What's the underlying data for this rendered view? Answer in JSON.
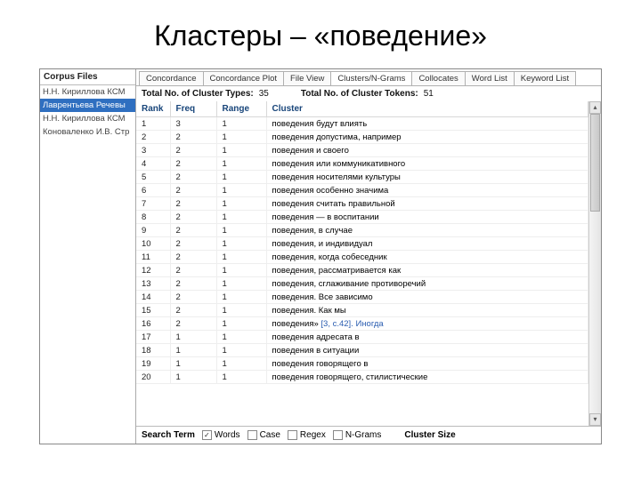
{
  "slide_title": "Кластеры – «поведение»",
  "left_pane_header": "Corpus Files",
  "files": [
    {
      "name": "Н.Н. Кириллова КСМ",
      "selected": false
    },
    {
      "name": "Лаврентьева Речевы",
      "selected": true
    },
    {
      "name": "Н.Н. Кириллова КСМ",
      "selected": false
    },
    {
      "name": "Коноваленко И.В. Стр",
      "selected": false
    }
  ],
  "tabs": [
    {
      "label": "Concordance",
      "active": false
    },
    {
      "label": "Concordance Plot",
      "active": false
    },
    {
      "label": "File View",
      "active": false
    },
    {
      "label": "Clusters/N-Grams",
      "active": true
    },
    {
      "label": "Collocates",
      "active": false
    },
    {
      "label": "Word List",
      "active": false
    },
    {
      "label": "Keyword List",
      "active": false
    }
  ],
  "totals": {
    "types_label": "Total No. of Cluster Types:",
    "types_value": "35",
    "tokens_label": "Total No. of Cluster Tokens:",
    "tokens_value": "51"
  },
  "columns": {
    "rank": "Rank",
    "freq": "Freq",
    "range": "Range",
    "cluster": "Cluster"
  },
  "rows": [
    {
      "rank": 1,
      "freq": 3,
      "range": 1,
      "cluster": "поведения будут влиять"
    },
    {
      "rank": 2,
      "freq": 2,
      "range": 1,
      "cluster": "поведения допустима, например"
    },
    {
      "rank": 3,
      "freq": 2,
      "range": 1,
      "cluster": "поведения и своего"
    },
    {
      "rank": 4,
      "freq": 2,
      "range": 1,
      "cluster": "поведения или коммуникативного"
    },
    {
      "rank": 5,
      "freq": 2,
      "range": 1,
      "cluster": "поведения носителями культуры"
    },
    {
      "rank": 6,
      "freq": 2,
      "range": 1,
      "cluster": "поведения особенно значима"
    },
    {
      "rank": 7,
      "freq": 2,
      "range": 1,
      "cluster": "поведения считать правильной"
    },
    {
      "rank": 8,
      "freq": 2,
      "range": 1,
      "cluster": "поведения — в воспитании"
    },
    {
      "rank": 9,
      "freq": 2,
      "range": 1,
      "cluster": "поведения, в случае"
    },
    {
      "rank": 10,
      "freq": 2,
      "range": 1,
      "cluster": "поведения, и индивидуал"
    },
    {
      "rank": 11,
      "freq": 2,
      "range": 1,
      "cluster": "поведения, когда собеседник"
    },
    {
      "rank": 12,
      "freq": 2,
      "range": 1,
      "cluster": "поведения, рассматривается как"
    },
    {
      "rank": 13,
      "freq": 2,
      "range": 1,
      "cluster": "поведения, сглаживание противоречий"
    },
    {
      "rank": 14,
      "freq": 2,
      "range": 1,
      "cluster": "поведения. Все зависимо"
    },
    {
      "rank": 15,
      "freq": 2,
      "range": 1,
      "cluster": "поведения. Как мы"
    },
    {
      "rank": 16,
      "freq": 2,
      "range": 1,
      "cluster": "поведения» [3, с.42]. Иногда",
      "ref": true
    },
    {
      "rank": 17,
      "freq": 1,
      "range": 1,
      "cluster": "поведения адресата в"
    },
    {
      "rank": 18,
      "freq": 1,
      "range": 1,
      "cluster": "поведения в ситуации"
    },
    {
      "rank": 19,
      "freq": 1,
      "range": 1,
      "cluster": "поведения говорящего в"
    },
    {
      "rank": 20,
      "freq": 1,
      "range": 1,
      "cluster": "поведения говорящего, стилистические"
    }
  ],
  "bottom": {
    "search_term_label": "Search Term",
    "words": "Words",
    "case": "Case",
    "regex": "Regex",
    "ngrams": "N-Grams",
    "cluster_size_label": "Cluster Size"
  },
  "checks": {
    "words": true,
    "case": false,
    "regex": false,
    "ngrams": false
  }
}
